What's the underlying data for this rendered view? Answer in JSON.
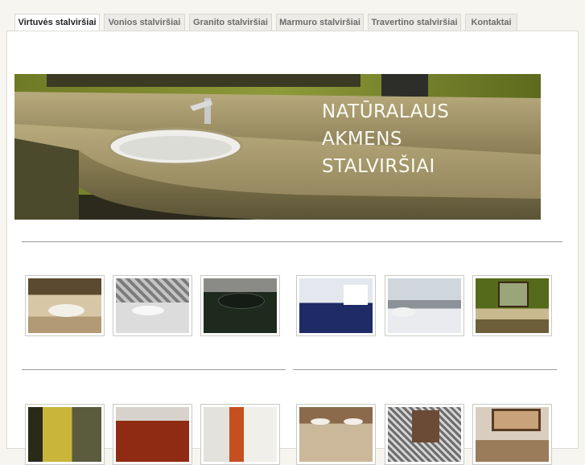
{
  "nav": {
    "tabs": [
      {
        "label": "Virtuvės stalviršiai",
        "active": true
      },
      {
        "label": "Vonios stalviršiai",
        "active": false
      },
      {
        "label": "Granito stalviršiai",
        "active": false
      },
      {
        "label": "Marmuro stalviršiai",
        "active": false
      },
      {
        "label": "Travertino stalviršiai",
        "active": false
      },
      {
        "label": "Kontaktai",
        "active": false
      }
    ]
  },
  "hero": {
    "lines": [
      "NATŪRALAUS",
      "AKMENS",
      "STALVIRŠIAI"
    ]
  },
  "gallery": {
    "row1": [
      "vanity-beige-round",
      "vanity-mosaic-grey",
      "vanity-dark-granite",
      "kitchen-blue-cabinets",
      "kitchen-grey-counter",
      "bath-olive-wall"
    ],
    "row2": [
      "kitchen-yellow-shelves",
      "kitchen-red-backsplash",
      "kitchen-white-orange",
      "vanity-double-sink",
      "bath-mosaic-mirror",
      "vanity-wood-mirror"
    ]
  },
  "colors": {
    "page_bg": "#f6f5ef",
    "tab_bg": "#ecebe7",
    "active_tab_bg": "#ffffff",
    "hero_text": "#fbfaf2"
  }
}
